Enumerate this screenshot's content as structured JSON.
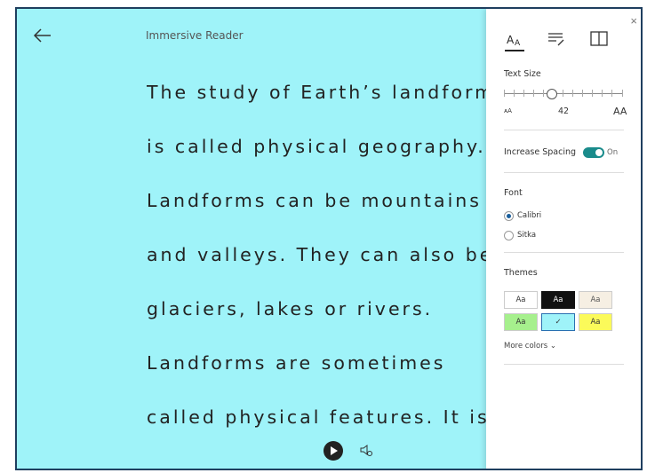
{
  "header": {
    "title": "Immersive Reader"
  },
  "reading": {
    "lines": [
      "The study of Earth’s landforms",
      "is called physical geography.",
      "Landforms can be mountains",
      "and valleys. They can also be",
      "glaciers, lakes or rivers.",
      "Landforms are sometimes",
      "called physical features. It is"
    ]
  },
  "panel": {
    "close": "×",
    "text_size": {
      "label": "Text Size",
      "min_label": "ᴀA",
      "value": "42",
      "max_label": "AA",
      "level_fraction": 0.39
    },
    "spacing": {
      "label": "Increase Spacing",
      "state": "On"
    },
    "font": {
      "label": "Font",
      "options": [
        "Calibri",
        "Sitka"
      ],
      "selected": "Calibri"
    },
    "themes": {
      "label": "Themes",
      "swatches": [
        {
          "text": "Aa",
          "bg": "#ffffff",
          "fg": "#333333"
        },
        {
          "text": "Aa",
          "bg": "#111111",
          "fg": "#ffffff"
        },
        {
          "text": "Aa",
          "bg": "#f6efe3",
          "fg": "#555555"
        },
        {
          "text": "Aa",
          "bg": "#a6f08d",
          "fg": "#333333"
        },
        {
          "text": "✓",
          "bg": "#9ff3f9",
          "fg": "#333333"
        },
        {
          "text": "Aa",
          "bg": "#fbfa5a",
          "fg": "#333333"
        }
      ],
      "more": "More colors ⌄"
    }
  },
  "colors": {
    "background": "#9ff3f9",
    "accent": "#1a8b8b"
  }
}
